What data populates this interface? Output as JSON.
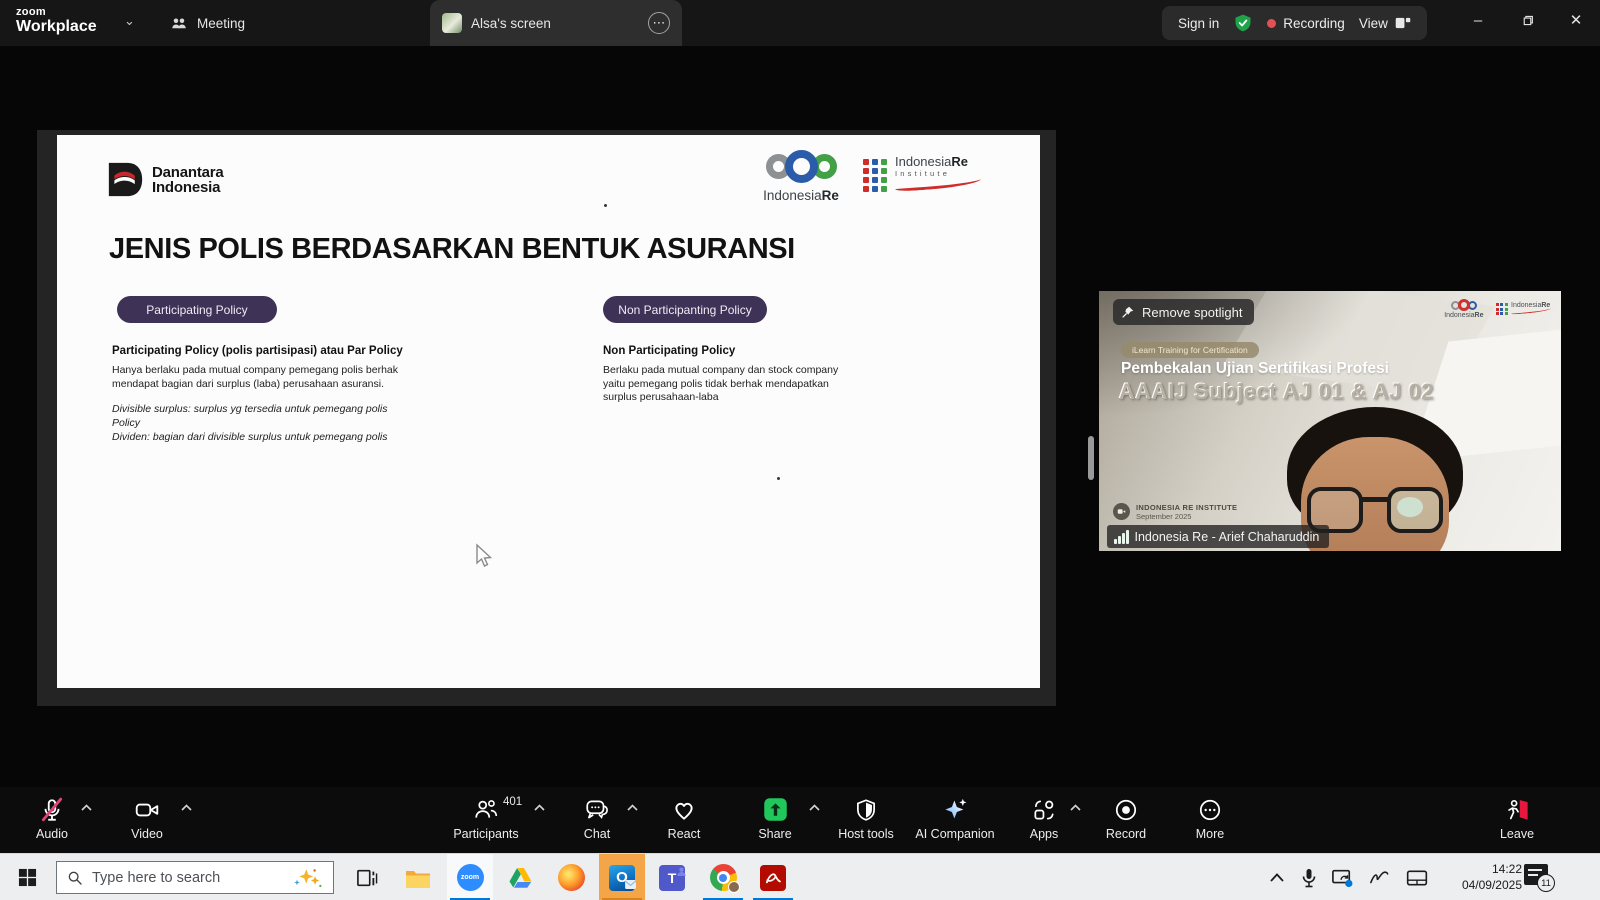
{
  "titlebar": {
    "brand_top": "zoom",
    "brand_bottom": "Workplace",
    "tab_meeting": "Meeting",
    "tab_screen": "Alsa's screen",
    "sign_in": "Sign in",
    "recording": "Recording",
    "view": "View"
  },
  "slide": {
    "danantara_line1": "Danantara",
    "danantara_line2": "Indonesia",
    "indonesiare_normal": "Indonesia",
    "indonesiare_bold": "Re",
    "institute_line1_normal": "Indonesia",
    "institute_line1_bold": "Re",
    "institute_line2": "Institute",
    "title": "JENIS POLIS BERDASARKAN BENTUK ASURANSI",
    "left_button": "Participating Policy",
    "left_heading": "Participating Policy (polis partisipasi) atau Par Policy",
    "left_body": "Hanya berlaku pada mutual company pemegang polis berhak mendapat bagian dari surplus (laba) perusahaan asuransi.",
    "left_note1": "Divisible surplus: surplus yg tersedia untuk pemegang polis Policy",
    "left_note2": "Dividen: bagian dari divisible surplus untuk pemegang polis",
    "right_button": "Non Participanting Policy",
    "right_heading": "Non Participating Policy",
    "right_body": "Berlaku pada mutual company dan stock company yaitu pemegang polis tidak berhak mendapatkan surplus perusahaan-laba"
  },
  "video": {
    "remove_spotlight": "Remove spotlight",
    "badge": "iLearn Training for Certification",
    "title": "Pembekalan Ujian Sertifikasi Profesi",
    "subtitle": "AAAIJ Subject AJ 01 & AJ 02",
    "watermark_line1": "INDONESIA RE INSTITUTE",
    "watermark_line2": "September 2025",
    "name_label": "Indonesia Re - Arief Chaharuddin",
    "mini_logo_normal": "Indonesia",
    "mini_logo_bold": "Re"
  },
  "toolbar": {
    "audio": "Audio",
    "video": "Video",
    "participants": "Participants",
    "participants_count": "401",
    "chat": "Chat",
    "react": "React",
    "share": "Share",
    "host_tools": "Host tools",
    "ai_companion": "AI Companion",
    "apps": "Apps",
    "record": "Record",
    "more": "More",
    "leave": "Leave"
  },
  "taskbar": {
    "search_placeholder": "Type here to search",
    "zoom_label": "zoom",
    "outlook_letter": "O",
    "teams_letter": "T",
    "time": "14:22",
    "date": "04/09/2025",
    "notification_count": "11"
  },
  "icons": {
    "ellipsis": "⋯",
    "minimize": "–",
    "close": "✕",
    "more_dots": "⋯",
    "brand_chevron": "⌄"
  },
  "colors": {
    "accent_purple": "#3e3356",
    "share_green": "#20c85c",
    "record_red": "#e05151",
    "shield_green": "#1ea24a",
    "leave_red": "#e8173d",
    "mic_muted_pink": "#e0437a",
    "taskbar_underline_blue": "#0078d7",
    "outlook_flash_orange": "#f3a03e"
  }
}
